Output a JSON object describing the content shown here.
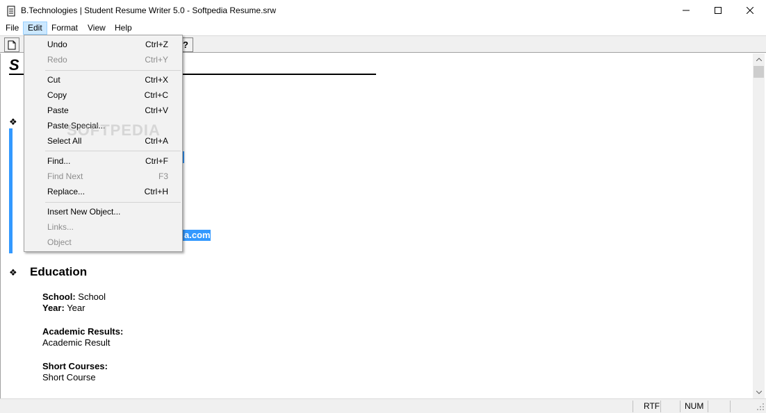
{
  "window": {
    "title": "B.Technologies | Student Resume Writer 5.0 - Softpedia Resume.srw",
    "minimize_glyph": "—",
    "maximize_glyph": "☐",
    "close_glyph": "✕"
  },
  "menubar": {
    "items": [
      "File",
      "Edit",
      "Format",
      "View",
      "Help"
    ],
    "active": "Edit"
  },
  "toolbar": {
    "new_glyph": "🗋",
    "help_glyph": "?"
  },
  "document": {
    "title_visible": "S",
    "email_fragment": "a.com",
    "sections": [
      {
        "heading": "Education",
        "lines": [
          {
            "label": "School:",
            "value": " School"
          },
          {
            "label": "Year:",
            "value": " Year"
          },
          {
            "label": "Academic Results:",
            "value": ""
          },
          {
            "label": "",
            "value": "Academic Result"
          },
          {
            "label": "Short Courses:",
            "value": ""
          },
          {
            "label": "",
            "value": "Short Course"
          }
        ]
      }
    ],
    "bullet_glyph": "❖"
  },
  "edit_menu": {
    "items": [
      {
        "label": "Undo",
        "shortcut": "Ctrl+Z",
        "enabled": true
      },
      {
        "label": "Redo",
        "shortcut": "Ctrl+Y",
        "enabled": false
      },
      {
        "label": "Cut",
        "shortcut": "Ctrl+X",
        "enabled": true
      },
      {
        "label": "Copy",
        "shortcut": "Ctrl+C",
        "enabled": true
      },
      {
        "label": "Paste",
        "shortcut": "Ctrl+V",
        "enabled": true
      },
      {
        "label": "Paste Special...",
        "shortcut": "",
        "enabled": true
      },
      {
        "label": "Select All",
        "shortcut": "Ctrl+A",
        "enabled": true
      },
      {
        "label": "Find...",
        "shortcut": "Ctrl+F",
        "enabled": true
      },
      {
        "label": "Find Next",
        "shortcut": "F3",
        "enabled": false
      },
      {
        "label": "Replace...",
        "shortcut": "Ctrl+H",
        "enabled": true
      },
      {
        "label": "Insert New Object...",
        "shortcut": "",
        "enabled": true
      },
      {
        "label": "Links...",
        "shortcut": "",
        "enabled": false
      },
      {
        "label": "Object",
        "shortcut": "",
        "enabled": false
      }
    ]
  },
  "statusbar": {
    "mode": "RTF",
    "numlock": "NUM"
  },
  "watermark": "SOFTPEDIA"
}
